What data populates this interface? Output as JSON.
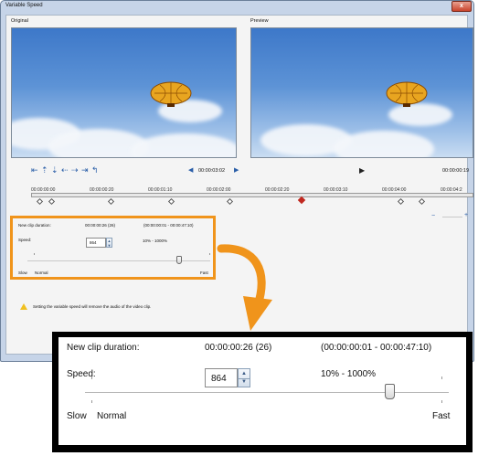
{
  "window": {
    "title": "Variable Speed",
    "close_label": "x"
  },
  "original": {
    "label": "Original"
  },
  "preview": {
    "label": "Preview"
  },
  "controls": {
    "original_timecode": "00:00:03:02",
    "preview_timecode": "00:00:00:19"
  },
  "timeline": {
    "labels": [
      "00:00:00:00",
      "00:00:00:20",
      "00:00:01:10",
      "00:00:02:00",
      "00:00:02:20",
      "00:00:03:10",
      "00:00:04:00",
      "00:00:04:2"
    ]
  },
  "speed_panel": {
    "new_clip_duration_label": "New clip duration:",
    "new_clip_duration_value": "00:00:00:26 (26)",
    "range_value": "(00:00:00:01 - 00:00:47:10)",
    "speed_label": "Speed:",
    "speed_value": "864",
    "speed_range": "10% - 1000%",
    "slow_label": "Slow",
    "normal_label": "Normal",
    "fast_label": "Fast",
    "slider_position": 0.86
  },
  "warning": {
    "text": "Setting the variable speed will remove the audio of the video clip."
  },
  "colors": {
    "highlight": "#f0941b",
    "accent": "#2a5ea8"
  }
}
